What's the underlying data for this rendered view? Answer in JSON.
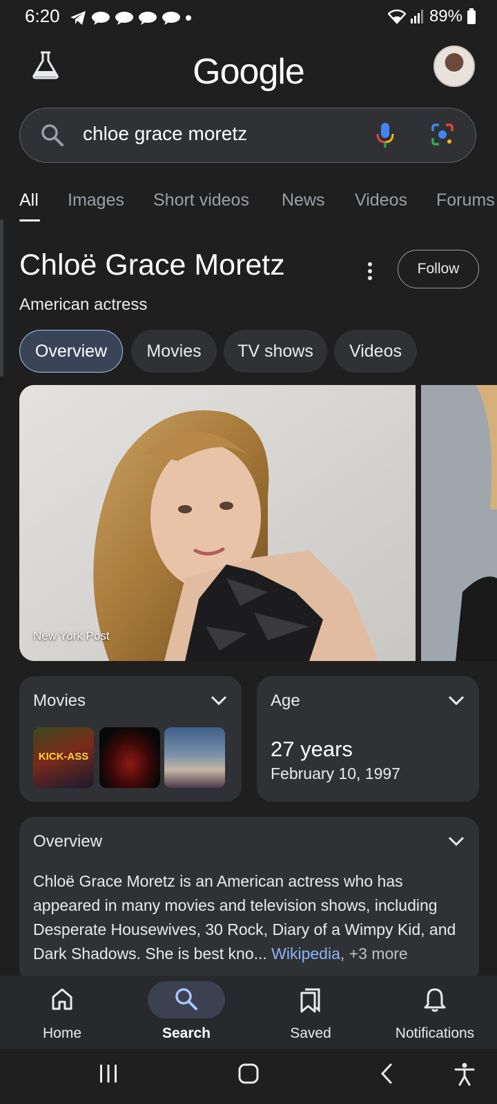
{
  "status_bar": {
    "time": "6:20",
    "battery": "89%"
  },
  "header": {
    "logo": "Google",
    "lab_icon": "flask-icon",
    "avatar_icon": "profile-avatar"
  },
  "search": {
    "query": "chloe grace moretz",
    "search_icon": "search-icon",
    "voice_icon": "mic-icon",
    "lens_icon": "camera-lens-icon"
  },
  "tabs": [
    {
      "label": "All",
      "active": true
    },
    {
      "label": "Images"
    },
    {
      "label": "Short videos"
    },
    {
      "label": "News"
    },
    {
      "label": "Videos"
    },
    {
      "label": "Forums"
    }
  ],
  "entity": {
    "title": "Chloë Grace Moretz",
    "subtitle": "American actress",
    "follow_label": "Follow",
    "chips": [
      {
        "label": "Overview",
        "active": true
      },
      {
        "label": "Movies"
      },
      {
        "label": "TV shows"
      },
      {
        "label": "Videos"
      }
    ],
    "image_source": "New York Post"
  },
  "movies_card": {
    "title": "Movies",
    "posters": [
      "KICK-ASS",
      "",
      ""
    ]
  },
  "age_card": {
    "title": "Age",
    "value": "27 years",
    "birth_date": "February 10, 1997"
  },
  "overview_card": {
    "title": "Overview",
    "text": "Chloë Grace Moretz is an American actress who has appeared in many movies and television shows, including Desperate Housewives, 30 Rock, Diary of a Wimpy Kid, and Dark Shadows. She is best kno",
    "ellipsis": "...",
    "source_link": "Wikipedia",
    "more": ", +3 more"
  },
  "bottom_nav": [
    {
      "label": "Home",
      "icon": "home-icon"
    },
    {
      "label": "Search",
      "icon": "search-icon",
      "active": true
    },
    {
      "label": "Saved",
      "icon": "bookmark-icon"
    },
    {
      "label": "Notifications",
      "icon": "bell-icon"
    }
  ],
  "colors": {
    "background": "#1f1f1f",
    "surface": "#303134",
    "link": "#8ab4f8",
    "active_chip": "#394457"
  }
}
